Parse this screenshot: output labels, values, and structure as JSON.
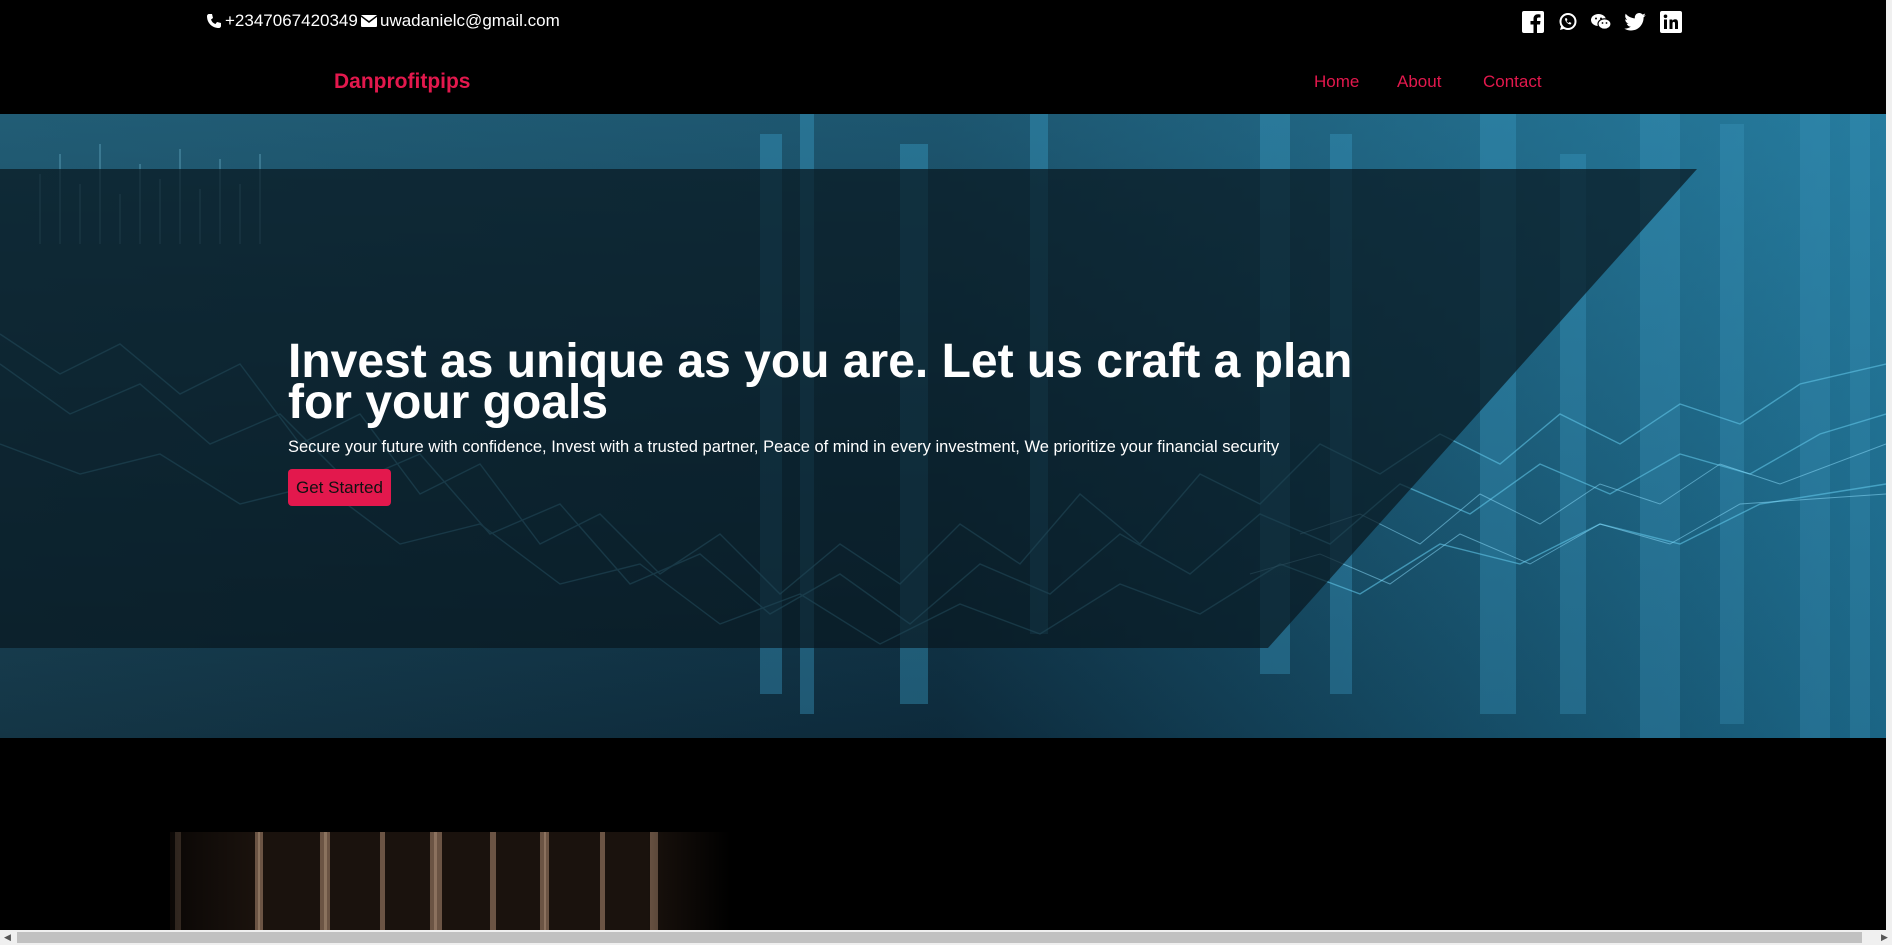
{
  "topbar": {
    "phone": "+2347067420349",
    "email": "uwadanielc@gmail.com",
    "socials": [
      {
        "icon": "facebook-icon"
      },
      {
        "icon": "whatsapp-icon"
      },
      {
        "icon": "wechat-icon"
      },
      {
        "icon": "twitter-icon"
      },
      {
        "icon": "linkedin-icon"
      }
    ]
  },
  "navbar": {
    "brand": "Danprofitpips",
    "links": [
      "Home",
      "About",
      "Contact"
    ]
  },
  "hero": {
    "headline": "Invest as unique as you are. Let us craft a plan for your goals",
    "subtitle": "Secure your future with confidence, Invest with a trusted partner, Peace of mind in every investment, We prioritize your financial security",
    "cta_label": "Get Started"
  },
  "colors": {
    "accent": "#e3184d",
    "background": "#000000"
  }
}
